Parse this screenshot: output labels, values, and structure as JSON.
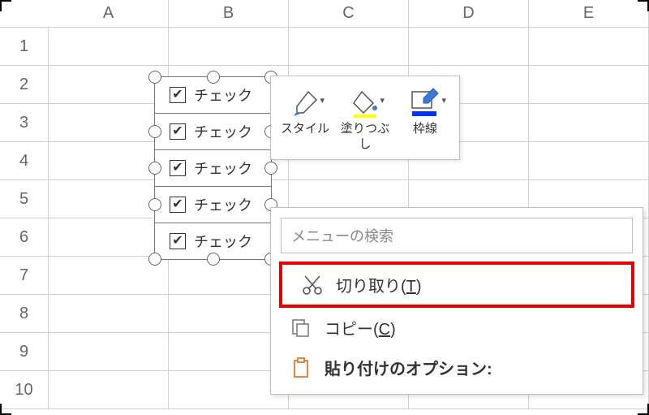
{
  "columns": [
    "A",
    "B",
    "C",
    "D",
    "E"
  ],
  "rows": [
    "1",
    "2",
    "3",
    "4",
    "5",
    "6",
    "7",
    "8",
    "9",
    "10"
  ],
  "checkbox": {
    "label": "チェック",
    "check_glyph": "✔"
  },
  "mini_toolbar": {
    "style": {
      "label": "スタイル"
    },
    "fill": {
      "label": "塗りつぶし",
      "swatch_color": "#ffff00"
    },
    "outline": {
      "label": "枠線",
      "swatch_color": "#0033ff"
    }
  },
  "context_menu": {
    "search_placeholder": "メニューの検索",
    "cut": {
      "label": "切り取り(",
      "key": "T",
      "close": ")"
    },
    "copy": {
      "label": "コピー(",
      "key": "C",
      "close": ")"
    },
    "paste_options": {
      "label": "貼り付けのオプション:"
    }
  }
}
